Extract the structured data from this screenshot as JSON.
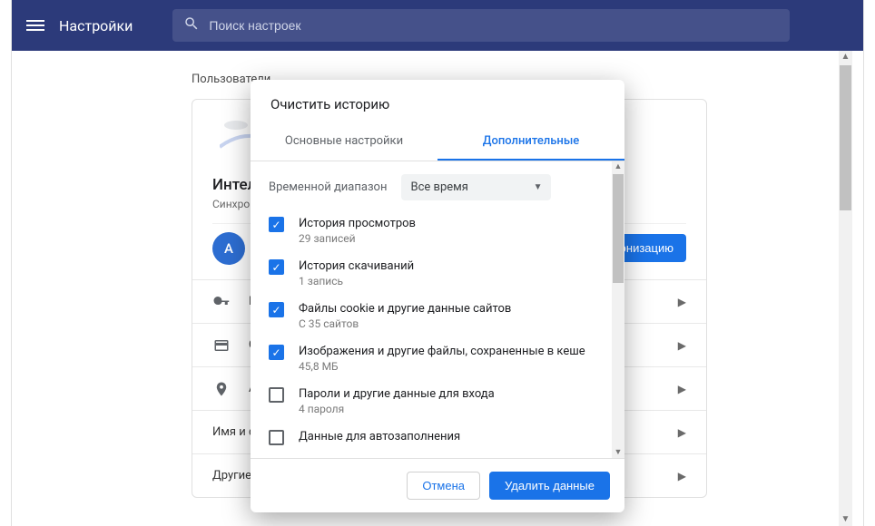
{
  "header": {
    "title": "Настройки",
    "search_placeholder": "Поиск настроек"
  },
  "section_label": "Пользователи",
  "card": {
    "heading": "Интеллектуальные функции",
    "subheading": "Синхронизация",
    "avatar_letter": "A",
    "account_name": "А",
    "sync_button": "Синхронизацию"
  },
  "rows": {
    "r1": "Пароли",
    "r2": "Способы оплаты",
    "r3": "Адреса",
    "r4": "Имя и фото профиля Chrome",
    "r5": "Другие пользователи"
  },
  "dialog": {
    "title": "Очистить историю",
    "tabs": {
      "basic": "Основные настройки",
      "advanced": "Дополнительные"
    },
    "range_label": "Временной диапазон",
    "range_value": "Все время",
    "options": [
      {
        "checked": true,
        "title": "История просмотров",
        "sub": "29 записей"
      },
      {
        "checked": true,
        "title": "История скачиваний",
        "sub": "1 запись"
      },
      {
        "checked": true,
        "title": "Файлы cookie и другие данные сайтов",
        "sub": "С 35 сайтов"
      },
      {
        "checked": true,
        "title": "Изображения и другие файлы, сохраненные в кеше",
        "sub": "45,8 МБ"
      },
      {
        "checked": false,
        "title": "Пароли и другие данные для входа",
        "sub": "4 пароля"
      },
      {
        "checked": false,
        "title": "Данные для автозаполнения",
        "sub": ""
      }
    ],
    "cancel": "Отмена",
    "confirm": "Удалить данные"
  }
}
